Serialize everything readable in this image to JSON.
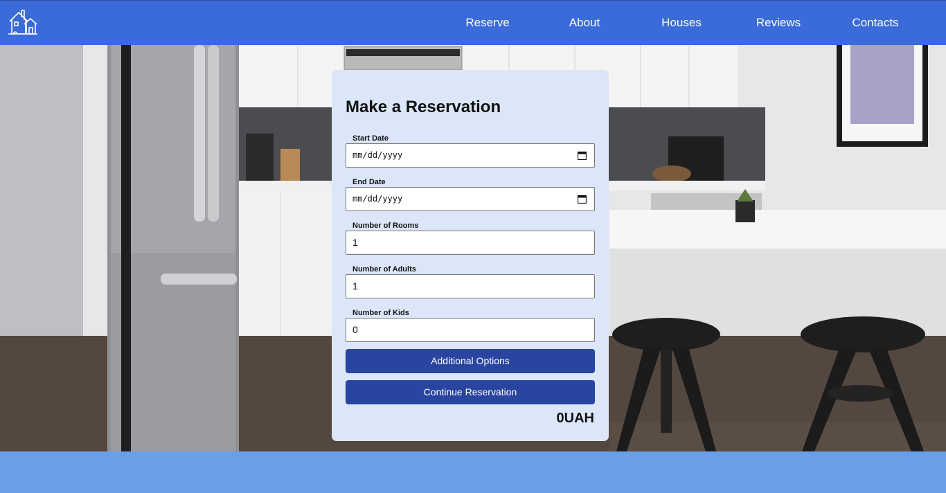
{
  "nav": {
    "logo_icon": "house-logo-icon",
    "links": [
      "Reserve",
      "About",
      "Houses",
      "Reviews",
      "Contacts"
    ]
  },
  "form": {
    "title": "Make a Reservation",
    "start_date": {
      "label": "Start Date",
      "placeholder": "mm/dd/yyyy"
    },
    "end_date": {
      "label": "End Date",
      "placeholder": "mm/dd/yyyy"
    },
    "rooms": {
      "label": "Number of Rooms",
      "value": "1"
    },
    "adults": {
      "label": "Number of Adults",
      "value": "1"
    },
    "kids": {
      "label": "Number of Kids",
      "value": "0"
    },
    "additional_options": "Additional Options",
    "continue": "Continue Reservation",
    "total": "0UAH"
  },
  "colors": {
    "navbar": "#3a6bd8",
    "card": "#dbe6f8",
    "button": "#2a45a0",
    "footer": "#6a9fe6"
  }
}
